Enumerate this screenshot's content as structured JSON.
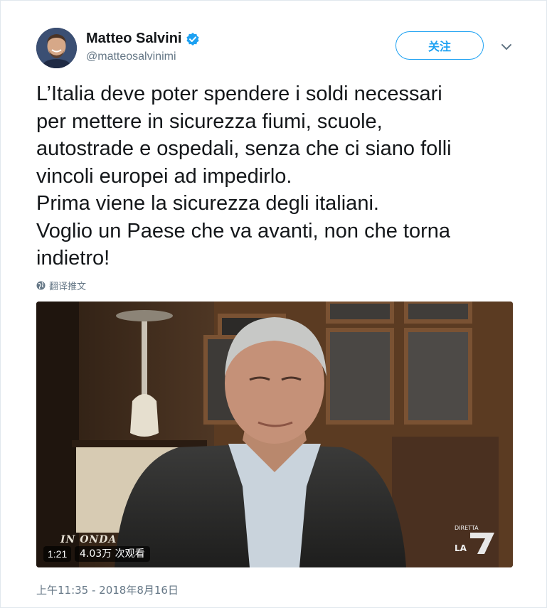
{
  "author": {
    "display_name": "Matteo Salvini",
    "handle": "@matteosalvinimi",
    "verified": true,
    "avatar_icon": "avatar-photo"
  },
  "follow_button": {
    "label": "关注"
  },
  "menu_icon": "chevron-down-icon",
  "tweet": {
    "lines": [
      "L’Italia deve poter spendere i soldi necessari",
      "per mettere in sicurezza fiumi, scuole,",
      "autostrade e ospedali, senza che ci siano folli",
      "vincoli europei ad impedirlo.",
      "Prima viene la sicurezza degli italiani.",
      "Voglio un Paese che va avanti, non che torna",
      "indietro!"
    ]
  },
  "translate": {
    "label": "翻译推文",
    "icon": "globe-icon"
  },
  "video": {
    "duration": "1:21",
    "views": "4.03万 次观看",
    "watermark_left": "IN ONDA",
    "watermark_right": "DIRETTA LA7"
  },
  "timestamp": "上午11:35 - 2018年8月16日",
  "colors": {
    "accent": "#1da1f2",
    "text": "#14171a",
    "muted": "#657786",
    "border": "#e1e8ed"
  }
}
